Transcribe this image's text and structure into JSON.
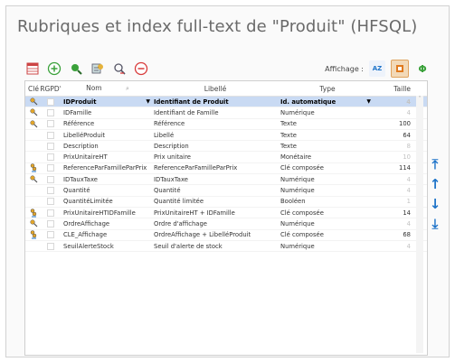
{
  "window": {
    "title": "Rubriques et index full-text de \"Produit\" (HFSQL)"
  },
  "toolbar": {
    "buttons": [
      {
        "name": "table-icon",
        "color": "#c44"
      },
      {
        "name": "add-icon",
        "color": "#3aa13a"
      },
      {
        "name": "zoom-icon",
        "color": "#2f8f3a"
      },
      {
        "name": "index-icon",
        "color": "#556"
      },
      {
        "name": "search-remove-icon",
        "color": "#556"
      },
      {
        "name": "remove-icon",
        "color": "#d83b3b"
      }
    ],
    "display_label": "Affichage :",
    "display_buttons": [
      {
        "name": "sort-az-icon",
        "label": "AZ"
      },
      {
        "name": "color-view-icon",
        "label": ""
      },
      {
        "name": "text-view-icon",
        "label": "Φ"
      }
    ]
  },
  "grid": {
    "headers": {
      "cle": "Clé",
      "rgpd": "RGPD",
      "nom": "Nom",
      "libelle": "Libellé",
      "type": "Type",
      "taille": "Taille"
    },
    "rows": [
      {
        "key": "key",
        "nom": "IDProduit",
        "libelle": "Identifiant de Produit",
        "type": "Id. automatique",
        "taille": "4",
        "taille_dim": true,
        "selected": true
      },
      {
        "key": "key",
        "nom": "IDFamille",
        "libelle": "Identifiant de Famille",
        "type": "Numérique",
        "taille": "4",
        "taille_dim": true
      },
      {
        "key": "key",
        "nom": "Référence",
        "libelle": "Référence",
        "type": "Texte",
        "taille": "100",
        "taille_dim": false
      },
      {
        "key": "",
        "nom": "LibelléProduit",
        "libelle": "Libellé",
        "type": "Texte",
        "taille": "64",
        "taille_dim": false
      },
      {
        "key": "",
        "nom": "Description",
        "libelle": "Description",
        "type": "Texte",
        "taille": "8",
        "taille_dim": true
      },
      {
        "key": "",
        "nom": "PrixUnitaireHT",
        "libelle": "Prix unitaire",
        "type": "Monétaire",
        "taille": "10",
        "taille_dim": true
      },
      {
        "key": "composite",
        "nom": "ReferenceParFamilleParPrix",
        "libelle": "ReferenceParFamilleParPrix",
        "type": "Clé composée",
        "taille": "114",
        "taille_dim": false
      },
      {
        "key": "key",
        "nom": "IDTauxTaxe",
        "libelle": "IDTauxTaxe",
        "type": "Numérique",
        "taille": "4",
        "taille_dim": true
      },
      {
        "key": "",
        "nom": "Quantité",
        "libelle": "Quantité",
        "type": "Numérique",
        "taille": "4",
        "taille_dim": true
      },
      {
        "key": "",
        "nom": "QuantitéLimitée",
        "libelle": "Quantité limitée",
        "type": "Booléen",
        "taille": "1",
        "taille_dim": true
      },
      {
        "key": "composite",
        "nom": "PrixUnitaireHTIDFamille",
        "libelle": "PrixUnitaireHT + IDFamille",
        "type": "Clé composée",
        "taille": "14",
        "taille_dim": false
      },
      {
        "key": "key",
        "nom": "OrdreAffichage",
        "libelle": "Ordre d'affichage",
        "type": "Numérique",
        "taille": "4",
        "taille_dim": true
      },
      {
        "key": "composite",
        "nom": "CLE_Affichage",
        "libelle": "OrdreAffichage + LibelléProduit",
        "type": "Clé composée",
        "taille": "68",
        "taille_dim": false
      },
      {
        "key": "",
        "nom": "SeuilAlerteStock",
        "libelle": "Seuil d'alerte de stock",
        "type": "Numérique",
        "taille": "4",
        "taille_dim": true
      }
    ]
  },
  "side_arrows": [
    {
      "name": "move-top-icon",
      "glyph": "⤒"
    },
    {
      "name": "move-up-icon",
      "glyph": "↑"
    },
    {
      "name": "move-down-icon",
      "glyph": "↓"
    },
    {
      "name": "move-bottom-icon",
      "glyph": "⤓"
    }
  ],
  "colors": {
    "accent": "#1f74c9",
    "selected_row": "#c9daf3"
  }
}
